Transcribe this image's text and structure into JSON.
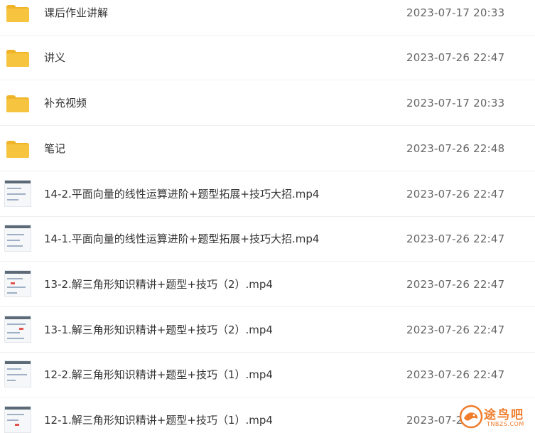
{
  "files": [
    {
      "type": "folder",
      "name": "课后作业讲解",
      "date": "2023-07-17 20:33",
      "icon": "folder-icon"
    },
    {
      "type": "folder",
      "name": "讲义",
      "date": "2023-07-26 22:47",
      "icon": "folder-icon"
    },
    {
      "type": "folder",
      "name": "补充视频",
      "date": "2023-07-17 20:33",
      "icon": "folder-icon"
    },
    {
      "type": "folder",
      "name": "笔记",
      "date": "2023-07-26 22:48",
      "icon": "folder-icon"
    },
    {
      "type": "video",
      "name": "14-2.平面向量的线性运算进阶+题型拓展+技巧大招.mp4",
      "date": "2023-07-26 22:47",
      "icon": "video-thumbnail"
    },
    {
      "type": "video",
      "name": "14-1.平面向量的线性运算进阶+题型拓展+技巧大招.mp4",
      "date": "2023-07-26 22:47",
      "icon": "video-thumbnail"
    },
    {
      "type": "video",
      "name": "13-2.解三角形知识精讲+题型+技巧（2）.mp4",
      "date": "2023-07-26 22:47",
      "icon": "video-thumbnail"
    },
    {
      "type": "video",
      "name": "13-1.解三角形知识精讲+题型+技巧（2）.mp4",
      "date": "2023-07-26 22:47",
      "icon": "video-thumbnail"
    },
    {
      "type": "video",
      "name": "12-2.解三角形知识精讲+题型+技巧（1）.mp4",
      "date": "2023-07-26 22:47",
      "icon": "video-thumbnail"
    },
    {
      "type": "video",
      "name": "12-1.解三角形知识精讲+题型+技巧（1）.mp4",
      "date": "2023-07-2",
      "icon": "video-thumbnail"
    }
  ],
  "watermark": {
    "text": "途鸟吧",
    "subtext": "TNBZS.COM",
    "color": "#ef7d2c"
  },
  "colors": {
    "folder_body": "#f7c43f",
    "folder_tab": "#f0b429",
    "text": "#333333",
    "date_text": "#666666",
    "divider": "#eef0f3"
  }
}
